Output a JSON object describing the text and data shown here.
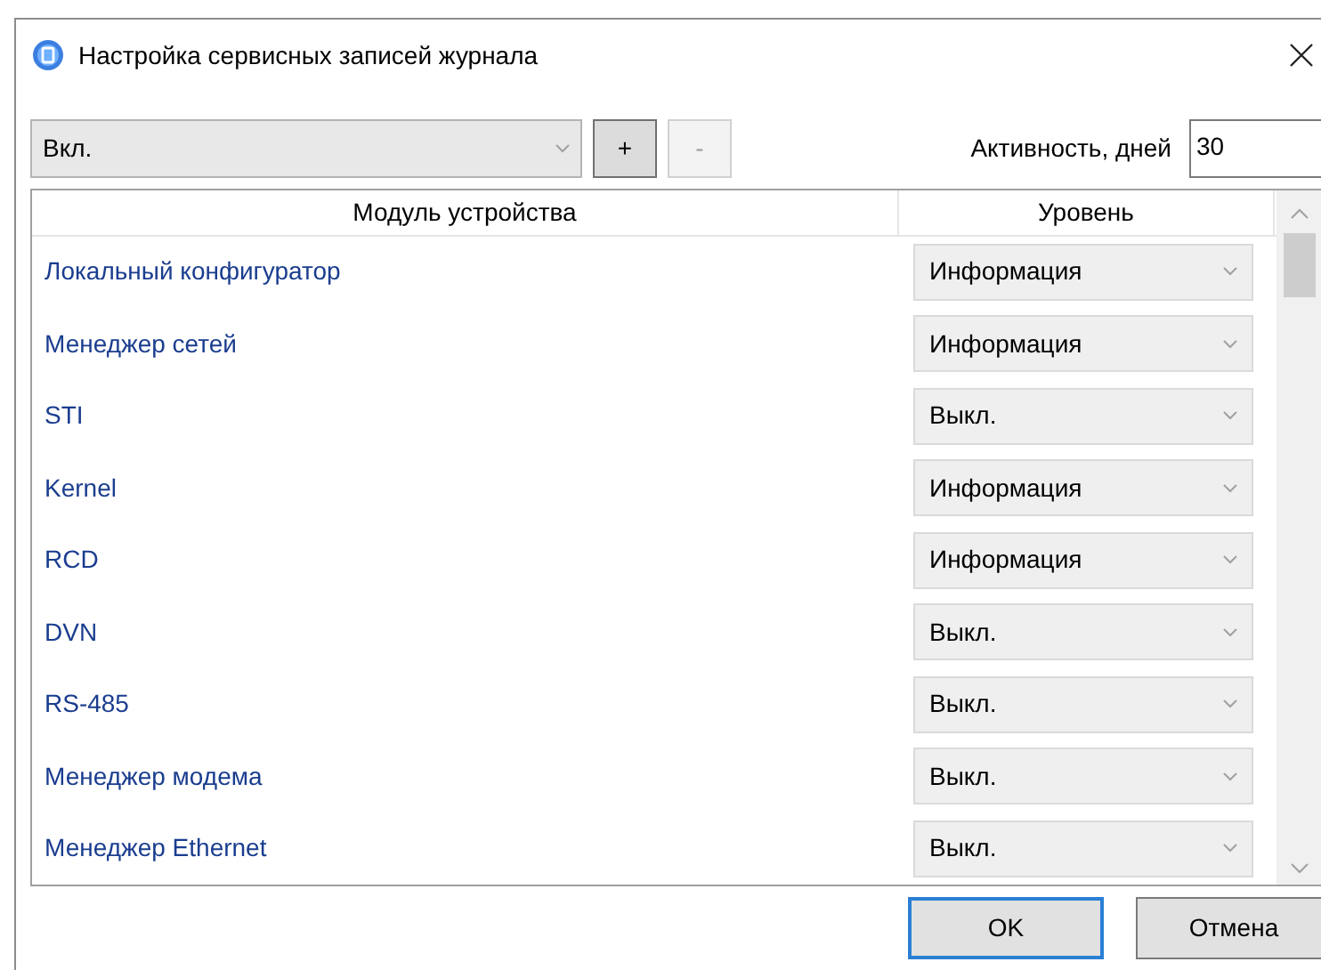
{
  "window": {
    "title": "Настройка сервисных записей журнала"
  },
  "toolbar": {
    "mode_select": {
      "value": "Вкл."
    },
    "buttons": [
      {
        "label": "+",
        "disabled": false
      },
      {
        "label": "-",
        "disabled": true
      }
    ],
    "activity": {
      "label": "Активность, дней",
      "value": "30"
    }
  },
  "table": {
    "columns": [
      "Модуль устройства",
      "Уровень"
    ],
    "rows": [
      {
        "module": "Локальный конфигуратор",
        "level": "Информация"
      },
      {
        "module": "Менеджер сетей",
        "level": "Информация"
      },
      {
        "module": "STI",
        "level": "Выкл."
      },
      {
        "module": "Kernel",
        "level": "Информация"
      },
      {
        "module": "RCD",
        "level": "Информация"
      },
      {
        "module": "DVN",
        "level": "Выкл."
      },
      {
        "module": "RS-485",
        "level": "Выкл."
      },
      {
        "module": "Менеджер модема",
        "level": "Выкл."
      },
      {
        "module": "Менеджер Ethernet",
        "level": "Выкл."
      }
    ]
  },
  "buttons": [
    {
      "label": "OK",
      "default": true
    },
    {
      "label": "Отмена",
      "default": false
    }
  ]
}
